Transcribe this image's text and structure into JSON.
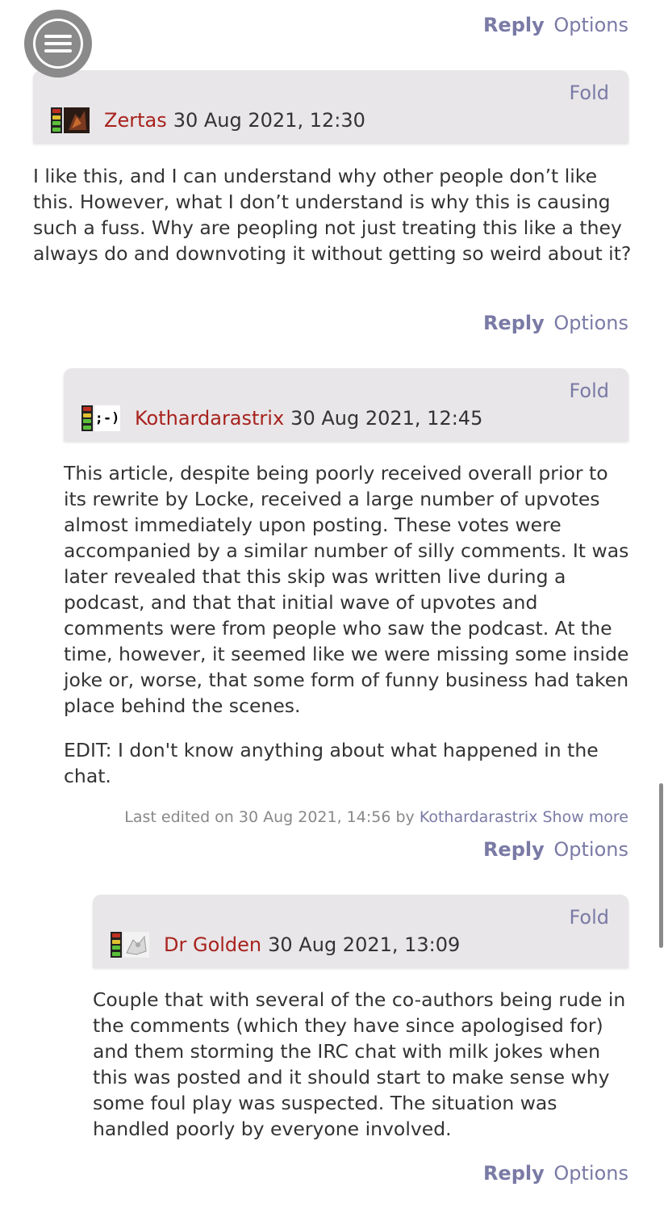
{
  "menu": {
    "icon": "hamburger-menu-icon"
  },
  "top_actions": {
    "reply": "Reply",
    "options": "Options"
  },
  "comments": [
    {
      "fold": "Fold",
      "user": "Zertas",
      "date": "30 Aug 2021, 12:30",
      "paragraphs": [
        "I like this, and I can understand why other people don’t like this. However, what I don’t understand is why this is causing such a fuss. Why are peopling not just treating this like a they always do and downvoting it without getting so weird about it?"
      ],
      "reply": "Reply",
      "options": "Options"
    },
    {
      "fold": "Fold",
      "user": "Kothardarastrix",
      "date": "30 Aug 2021, 12:45",
      "avatar_text": ";-)",
      "paragraphs": [
        "This article, despite being poorly received overall prior to its rewrite by Locke, received a large number of upvotes almost immediately upon posting. These votes were accompanied by a similar number of silly comments. It was later revealed that this skip was written live during a podcast, and that that initial wave of upvotes and comments were from people who saw the podcast. At the time, however, it seemed like we were missing some inside joke or, worse, that some form of funny business had taken place behind the scenes.",
        "EDIT: I don't know anything about what happened in the chat."
      ],
      "edited": {
        "prefix": "Last edited on 30 Aug 2021, 14:56 by",
        "editor": "Kothardarastrix",
        "show_more": "Show more"
      },
      "reply": "Reply",
      "options": "Options"
    },
    {
      "fold": "Fold",
      "user": "Dr Golden",
      "date": "30 Aug 2021, 13:09",
      "paragraphs": [
        "Couple that with several of the co-authors being rude in the comments (which they have since apologised for) and them storming the IRC chat with milk jokes when this was posted and it should start to make sense why some foul play was suspected. The situation was handled poorly by everyone involved."
      ],
      "reply": "Reply",
      "options": "Options"
    }
  ],
  "colors": {
    "accent": "#7a7aa6",
    "username": "#a8221e",
    "header_bg": "#e8e6e8",
    "rating_green": "#5cbf3a",
    "rating_yellow": "#e0c030",
    "rating_red": "#c03020"
  }
}
